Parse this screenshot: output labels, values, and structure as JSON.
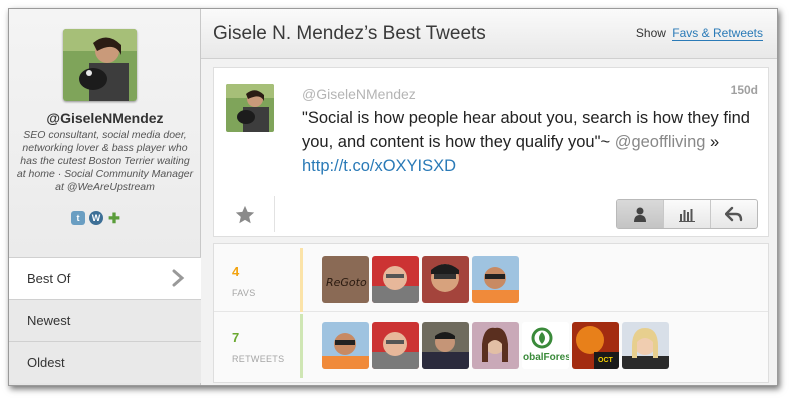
{
  "profile": {
    "handle": "@GiseleNMendez",
    "bio": "SEO consultant, social media doer, networking lover & bass player who has the cutest Boston Terrier waiting at home · Social Community Manager at @WeAreUpstream"
  },
  "social_icons": [
    "twitter-icon",
    "wordpress-icon",
    "plus-icon"
  ],
  "nav": {
    "items": [
      {
        "label": "Best Of"
      },
      {
        "label": "Newest"
      },
      {
        "label": "Oldest"
      }
    ]
  },
  "header": {
    "title": "Gisele N. Mendez’s Best Tweets",
    "show_label": "Show",
    "show_link": "Favs & Retweets"
  },
  "tweet": {
    "handle": "@GiseleNMendez",
    "age": "150d",
    "text_main": "\"Social is how people hear about you, search is how they find you, and content is how they qualify you\"~",
    "mention": "@geoffliving",
    "separator": " » ",
    "link": "http://t.co/xOXYISXD"
  },
  "stats": {
    "favs": {
      "count": "4",
      "label": "FAVS"
    },
    "retweets": {
      "count": "7",
      "label": "RETWEETS"
    }
  },
  "colors": {
    "favs": "#f2a30f",
    "retweets": "#6aa82f",
    "link": "#2a7ab7"
  }
}
